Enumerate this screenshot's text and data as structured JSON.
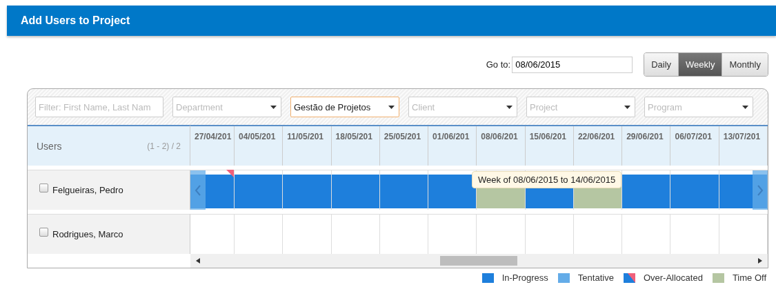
{
  "header": {
    "title": "Add Users to Project"
  },
  "goto": {
    "label": "Go to:",
    "value": "08/06/2015"
  },
  "view_modes": [
    {
      "label": "Daily",
      "selected": false
    },
    {
      "label": "Weekly",
      "selected": true
    },
    {
      "label": "Monthly",
      "selected": false
    }
  ],
  "filters": [
    {
      "kind": "text",
      "placeholder": "Filter: First Name, Last Nam"
    },
    {
      "kind": "select",
      "placeholder": "Department"
    },
    {
      "kind": "select",
      "value": "Gestão de Projetos"
    },
    {
      "kind": "select",
      "placeholder": "Client"
    },
    {
      "kind": "select",
      "placeholder": "Project"
    },
    {
      "kind": "select",
      "placeholder": "Program"
    }
  ],
  "users_header": {
    "label": "Users",
    "count": "(1 - 2) / 2"
  },
  "weeks": [
    "27/04/201",
    "04/05/201",
    "11/05/201",
    "18/05/201",
    "25/05/201",
    "01/06/201",
    "08/06/201",
    "15/06/201",
    "22/06/201",
    "29/06/201",
    "06/07/201",
    "13/07/201"
  ],
  "users": [
    {
      "name": "Felgueiras, Pedro",
      "checked": false,
      "cells": [
        {
          "kind": "in-progress",
          "over_allocated": true
        },
        {
          "kind": "in-progress",
          "over_allocated": false
        },
        {
          "kind": "in-progress",
          "over_allocated": false
        },
        {
          "kind": "in-progress",
          "over_allocated": false
        },
        {
          "kind": "in-progress",
          "over_allocated": false
        },
        {
          "kind": "in-progress",
          "over_allocated": false
        },
        {
          "kind": "time-off",
          "over_allocated": false
        },
        {
          "kind": "in-progress",
          "over_allocated": false
        },
        {
          "kind": "time-off",
          "over_allocated": false
        },
        {
          "kind": "in-progress",
          "over_allocated": false
        },
        {
          "kind": "in-progress",
          "over_allocated": false
        },
        {
          "kind": "in-progress",
          "over_allocated": false
        }
      ]
    },
    {
      "name": "Rodrigues, Marco",
      "checked": false
    }
  ],
  "tooltip": {
    "text": "Week of 08/06/2015 to 14/06/2015"
  },
  "legend": [
    {
      "kind": "in-progress",
      "label": "In-Progress"
    },
    {
      "kind": "tentative",
      "label": "Tentative"
    },
    {
      "kind": "over-allocated",
      "label": "Over-Allocated"
    },
    {
      "kind": "time-off",
      "label": "Time Off"
    }
  ]
}
